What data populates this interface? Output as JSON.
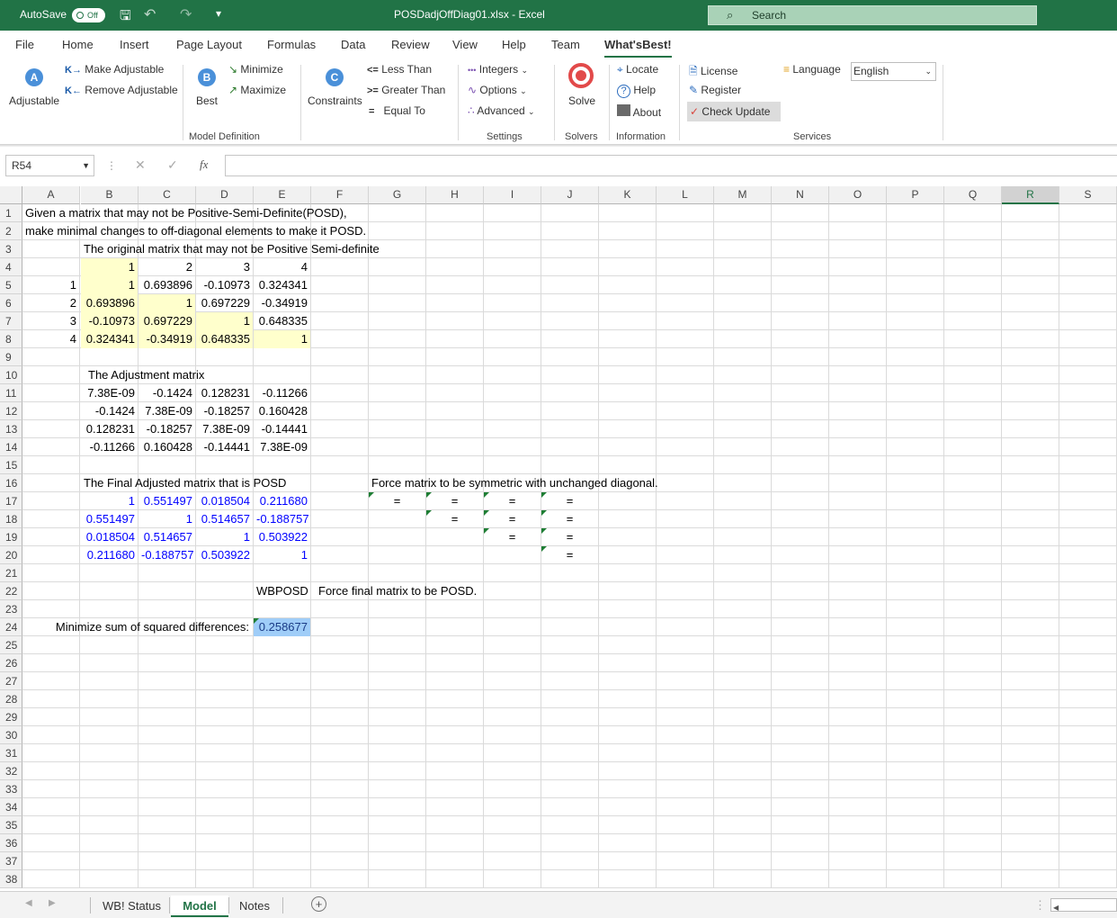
{
  "titlebar": {
    "autosave_label": "AutoSave",
    "autosave_state": "Off",
    "file_title": "POSDadjOffDiag01.xlsx  -  Excel",
    "search_placeholder": "Search"
  },
  "tabs": [
    "File",
    "Home",
    "Insert",
    "Page Layout",
    "Formulas",
    "Data",
    "Review",
    "View",
    "Help",
    "Team",
    "What'sBest!"
  ],
  "active_tab": "What'sBest!",
  "ribbon": {
    "adjustable": "Adjustable",
    "make_adjustable": "Make Adjustable",
    "remove_adjustable": "Remove Adjustable",
    "best": "Best",
    "minimize": "Minimize",
    "maximize": "Maximize",
    "constraints": "Constraints",
    "less_than": "Less Than",
    "greater_than": "Greater Than",
    "equal_to": "Equal To",
    "less_than_sym": "<=",
    "greater_than_sym": ">=",
    "equal_to_sym": "=",
    "integers": "Integers",
    "options": "Options",
    "advanced": "Advanced",
    "solve": "Solve",
    "locate": "Locate",
    "help": "Help",
    "about": "About",
    "license": "License",
    "register": "Register",
    "check_update": "Check Update",
    "language_label": "Language",
    "language_value": "English",
    "groups": {
      "model_definition": "Model Definition",
      "settings": "Settings",
      "solvers": "Solvers",
      "information": "Information",
      "services": "Services"
    }
  },
  "formula_bar": {
    "name_box": "R54",
    "fx": "fx",
    "formula": ""
  },
  "columns": [
    "A",
    "B",
    "C",
    "D",
    "E",
    "F",
    "G",
    "H",
    "I",
    "J",
    "K",
    "L",
    "M",
    "N",
    "O",
    "P",
    "Q",
    "R",
    "S"
  ],
  "selected_column": "R",
  "rows": [
    "1",
    "2",
    "3",
    "4",
    "5",
    "6",
    "7",
    "8",
    "9",
    "10",
    "11",
    "12",
    "13",
    "14",
    "15",
    "16",
    "17",
    "18",
    "19",
    "20",
    "21",
    "22",
    "23",
    "24",
    "25",
    "26",
    "27",
    "28",
    "29",
    "30",
    "31",
    "32",
    "33",
    "34",
    "35",
    "36",
    "37",
    "38"
  ],
  "sheet": {
    "line1": "Given a matrix that may not be Positive-Semi-Definite(POSD),",
    "line2": "make minimal changes to off-diagonal elements to make it POSD.",
    "orig_title": "The original matrix that may not be Positive Semi-definite",
    "orig_col_headers": [
      "1",
      "2",
      "3",
      "4"
    ],
    "orig_row_headers": [
      "1",
      "2",
      "3",
      "4"
    ],
    "orig_matrix": [
      [
        "1",
        "0.693896",
        "-0.10973",
        "0.324341"
      ],
      [
        "0.693896",
        "1",
        "0.697229",
        "-0.34919"
      ],
      [
        "-0.10973",
        "0.697229",
        "1",
        "0.648335"
      ],
      [
        "0.324341",
        "-0.34919",
        "0.648335",
        "1"
      ]
    ],
    "adj_title": "The Adjustment matrix",
    "adj_matrix": [
      [
        "7.38E-09",
        "-0.1424",
        "0.128231",
        "-0.11266"
      ],
      [
        "-0.1424",
        "7.38E-09",
        "-0.18257",
        "0.160428"
      ],
      [
        "0.128231",
        "-0.18257",
        "7.38E-09",
        "-0.14441"
      ],
      [
        "-0.11266",
        "0.160428",
        "-0.14441",
        "7.38E-09"
      ]
    ],
    "final_title": "The Final Adjusted matrix that is POSD",
    "final_matrix": [
      [
        "1",
        "0.551497",
        "0.018504",
        "0.211680"
      ],
      [
        "0.551497",
        "1",
        "0.514657",
        "-0.188757"
      ],
      [
        "0.018504",
        "0.514657",
        "1",
        "0.503922"
      ],
      [
        "0.211680",
        "-0.188757",
        "0.503922",
        "1"
      ]
    ],
    "symmetric_note": "Force matrix to be symmetric with unchanged diagonal.",
    "eq": "=",
    "wbposd": "WBPOSD",
    "posd_note": "Force final matrix to be POSD.",
    "objective_label": "Minimize sum of squared differences:",
    "objective_value": "0.258677"
  },
  "sheet_tabs": [
    "WB! Status",
    "Model",
    "Notes"
  ],
  "active_sheet": "Model"
}
